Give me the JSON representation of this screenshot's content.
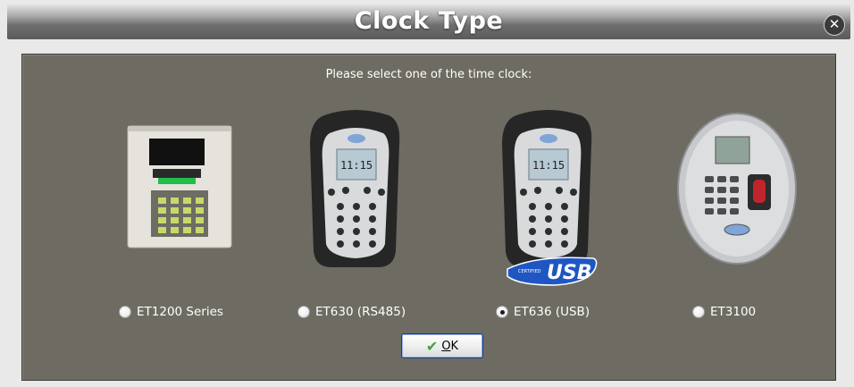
{
  "window": {
    "title": "Clock Type",
    "close_glyph": "✕"
  },
  "dialog": {
    "prompt": "Please select one of the time clock:",
    "options": [
      {
        "label": "ET1200 Series",
        "checked": false,
        "icon": "et1200-clock-icon"
      },
      {
        "label": "ET630 (RS485)",
        "checked": false,
        "icon": "et630-clock-icon"
      },
      {
        "label": "ET636 (USB)",
        "checked": true,
        "icon": "et636-clock-icon"
      },
      {
        "label": "ET3100",
        "checked": false,
        "icon": "et3100-clock-icon"
      }
    ],
    "usb_badge": "USB",
    "usb_badge_small": "CERTIFIED",
    "device_screen_time": "11:15",
    "ok_label": "OK"
  },
  "colors": {
    "panel_bg": "#6e6b62",
    "usb_badge": "#1f56c4",
    "ok_border": "#1c3c8a"
  }
}
